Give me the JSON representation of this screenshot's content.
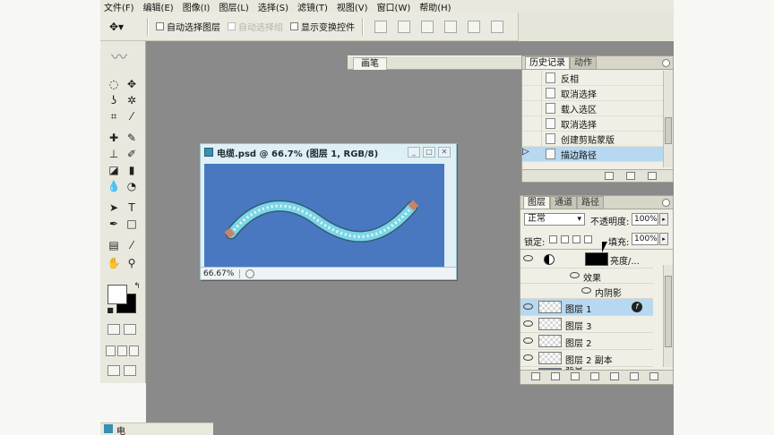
{
  "menubar": {
    "items": [
      "文件(F)",
      "编辑(E)",
      "图像(I)",
      "图层(L)",
      "选择(S)",
      "滤镜(T)",
      "视图(V)",
      "窗口(W)",
      "帮助(H)"
    ]
  },
  "options": {
    "auto_select_layer": "自动选择图层",
    "auto_select_group": "自动选择组",
    "show_transform": "显示变换控件"
  },
  "brush_tab": {
    "label": "画笔"
  },
  "document": {
    "title": "电缆.psd @ 66.7% (图层 1, RGB/8)",
    "zoom": "66.67%",
    "canvas_color": "#4a78c0",
    "cable_color": "#7dd6e6"
  },
  "history": {
    "tabs": [
      "历史记录",
      "动作"
    ],
    "items": [
      "反相",
      "取消选择",
      "载入选区",
      "取消选择",
      "创建剪贴蒙版",
      "描边路径"
    ],
    "selected_index": 5
  },
  "layers": {
    "tabs": [
      "图层",
      "通道",
      "路径"
    ],
    "blend_mode": "正常",
    "opacity_label": "不透明度:",
    "opacity": "100%",
    "lock_label": "锁定:",
    "fill_label": "填充:",
    "fill": "100%",
    "rows": [
      {
        "name": "亮度/...",
        "kind": "adjustment"
      },
      {
        "name": "效果",
        "kind": "effects"
      },
      {
        "name": "内阴影",
        "kind": "effect"
      },
      {
        "name": "图层 1",
        "kind": "layer",
        "selected": true
      },
      {
        "name": "图层 3",
        "kind": "layer"
      },
      {
        "name": "图层 2",
        "kind": "layer"
      },
      {
        "name": "图层 2 副本",
        "kind": "layer"
      },
      {
        "name": "背景",
        "kind": "background"
      }
    ]
  },
  "taskbar": {
    "doc_label": "电"
  }
}
